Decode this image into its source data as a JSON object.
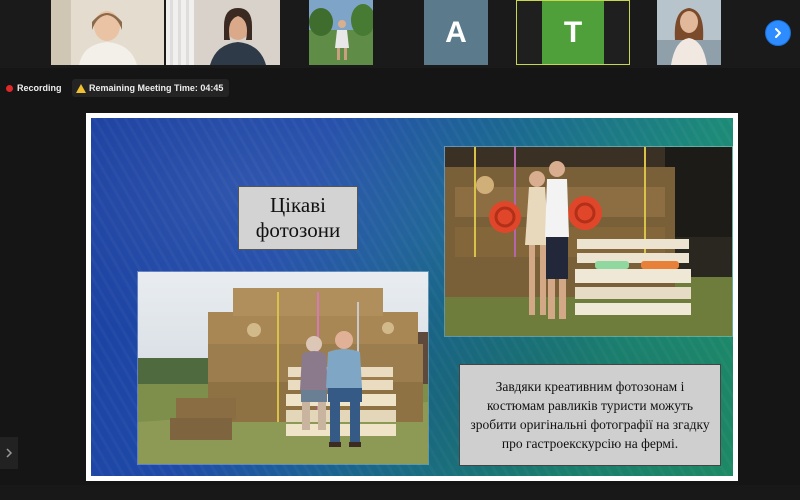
{
  "gallery": {
    "participants": [
      {
        "kind": "video",
        "name": "participant-1"
      },
      {
        "kind": "video",
        "name": "participant-2"
      },
      {
        "kind": "video",
        "name": "participant-3"
      },
      {
        "kind": "avatar",
        "initial": "A",
        "color": "#5b7b8c"
      },
      {
        "kind": "avatar",
        "initial": "T",
        "color": "#4fa03a"
      },
      {
        "kind": "video",
        "name": "participant-6"
      }
    ],
    "next_icon": "chevron-right-icon"
  },
  "status": {
    "recording_label": "Recording",
    "remaining_label": "Remaining Meeting Time: 04:45"
  },
  "slide": {
    "title_line1": "Цікаві",
    "title_line2": "фотозони",
    "caption": "Завдяки креативним фотозонам і костюмам равликів туристи можуть зробити оригінальні фотографії на згадку про гастроекскурсію на фермі."
  }
}
